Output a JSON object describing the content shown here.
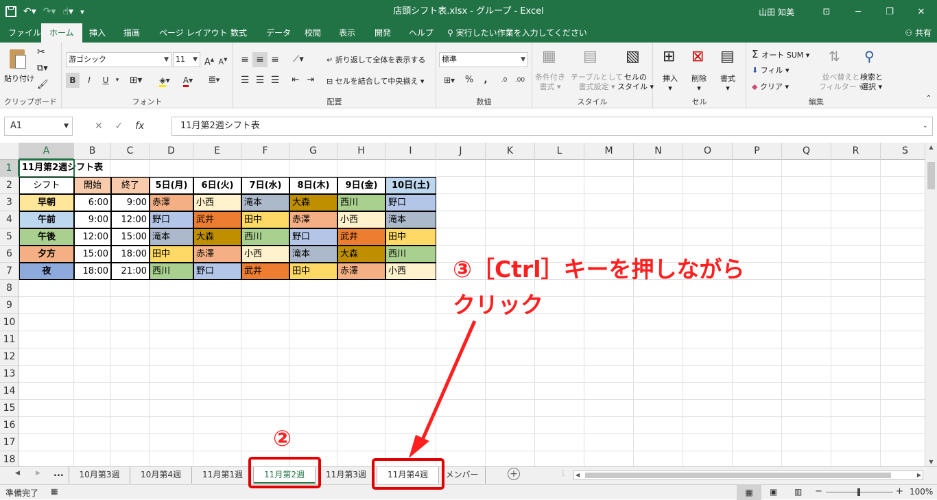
{
  "window": {
    "title": "店頭シフト表.xlsx  -  グループ  -  Excel",
    "user": "山田 知美",
    "qat": {
      "save_icon": "save-icon",
      "undo_icon": "undo-icon",
      "redo_icon": "redo-icon",
      "touch_icon": "touch-mode-icon",
      "more_icon": "customize-qat-icon"
    },
    "controls": {
      "ribbon_display": "ribbon-display-icon",
      "minimize": "minimize-icon",
      "restore": "restore-icon",
      "close": "close-icon"
    }
  },
  "ribbon_tabs": [
    {
      "label": "ファイル"
    },
    {
      "label": "ホーム",
      "active": true
    },
    {
      "label": "挿入"
    },
    {
      "label": "描画"
    },
    {
      "label": "ページ レイアウト"
    },
    {
      "label": "数式"
    },
    {
      "label": "データ"
    },
    {
      "label": "校閲"
    },
    {
      "label": "表示"
    },
    {
      "label": "開発"
    },
    {
      "label": "ヘルプ"
    }
  ],
  "tell_me": "実行したい作業を入力してください",
  "share": "共有",
  "groups": {
    "clipboard": {
      "label": "クリップボード",
      "paste": "貼り付け"
    },
    "font": {
      "label": "フォント",
      "font_name": "游ゴシック",
      "font_size": "11",
      "bold": "B",
      "italic": "I",
      "underline": "U"
    },
    "alignment": {
      "label": "配置",
      "wrap": "折り返して全体を表示する",
      "merge": "セルを結合して中央揃え"
    },
    "number": {
      "label": "数値",
      "format": "標準"
    },
    "styles": {
      "label": "スタイル",
      "conditional": [
        "条件付き",
        "書式"
      ],
      "table": [
        "テーブルとして",
        "書式設定"
      ],
      "cell": [
        "セルの",
        "スタイル"
      ]
    },
    "cells": {
      "label": "セル",
      "insert": "挿入",
      "delete": "削除",
      "format": "書式"
    },
    "editing": {
      "label": "編集",
      "autosum": "オート SUM",
      "fill": "フィル",
      "clear": "クリア",
      "sort": [
        "並べ替えと",
        "フィルター"
      ],
      "find": [
        "検索と",
        "選択"
      ]
    }
  },
  "formula_bar": {
    "name_box": "A1",
    "fx": "fx",
    "content": "11月第2週シフト表"
  },
  "columns": [
    "A",
    "B",
    "C",
    "D",
    "E",
    "F",
    "G",
    "H",
    "I",
    "J",
    "K",
    "L",
    "M",
    "N",
    "O",
    "P",
    "Q",
    "R",
    "S"
  ],
  "rows": [
    "1",
    "2",
    "3",
    "4",
    "5",
    "6",
    "7",
    "8",
    "9",
    "10",
    "11",
    "12",
    "13",
    "14",
    "15",
    "16",
    "17",
    "18"
  ],
  "table": {
    "title": "11月第2週シフト表",
    "header": [
      "シフト",
      "開始",
      "終了",
      "5日(月)",
      "6日(火)",
      "7日(水)",
      "8日(木)",
      "9日(金)",
      "10日(土)"
    ],
    "rows": [
      {
        "shift": "早朝",
        "start": "6:00",
        "end": "9:00",
        "names": [
          "赤澤",
          "小西",
          "滝本",
          "大森",
          "西川",
          "野口"
        ]
      },
      {
        "shift": "午前",
        "start": "9:00",
        "end": "12:00",
        "names": [
          "野口",
          "武井",
          "田中",
          "赤澤",
          "小西",
          "滝本"
        ]
      },
      {
        "shift": "午後",
        "start": "12:00",
        "end": "15:00",
        "names": [
          "滝本",
          "大森",
          "西川",
          "野口",
          "武井",
          "田中"
        ]
      },
      {
        "shift": "夕方",
        "start": "15:00",
        "end": "18:00",
        "names": [
          "田中",
          "赤澤",
          "小西",
          "滝本",
          "大森",
          "西川"
        ]
      },
      {
        "shift": "夜",
        "start": "18:00",
        "end": "21:00",
        "names": [
          "西川",
          "野口",
          "武井",
          "田中",
          "赤澤",
          "小西"
        ]
      }
    ]
  },
  "colors": {
    "excel_green": "#217346",
    "shift": {
      "早朝": "#ffe699",
      "午前": "#bdd7ee",
      "午後": "#a9d08e",
      "夕方": "#f4b084",
      "夜": "#8ea9db"
    },
    "header_pink": "#f8cbad",
    "header_sat": "#bdd7ee",
    "names": {
      "赤澤": "#f4b084",
      "小西": "#fff2cc",
      "滝本": "#acb9ca",
      "大森": "#bf8f00",
      "西川": "#a9d08e",
      "野口": "#b4c6e7",
      "武井": "#ed7d31",
      "田中": "#ffd966"
    },
    "annotation": "#ff1f1f"
  },
  "sheet_tabs": [
    "10月第3週",
    "10月第4週",
    "11月第1週",
    "11月第2週",
    "11月第3週",
    "11月第4週",
    "メンバー"
  ],
  "sheet_tabs_more": "...",
  "active_sheet": "11月第2週",
  "status": {
    "ready": "準備完了",
    "zoom": "100%"
  },
  "annotations": {
    "step2": "②",
    "step3_line1": "③［Ctrl］キーを押しながら",
    "step3_line2": "クリック"
  }
}
